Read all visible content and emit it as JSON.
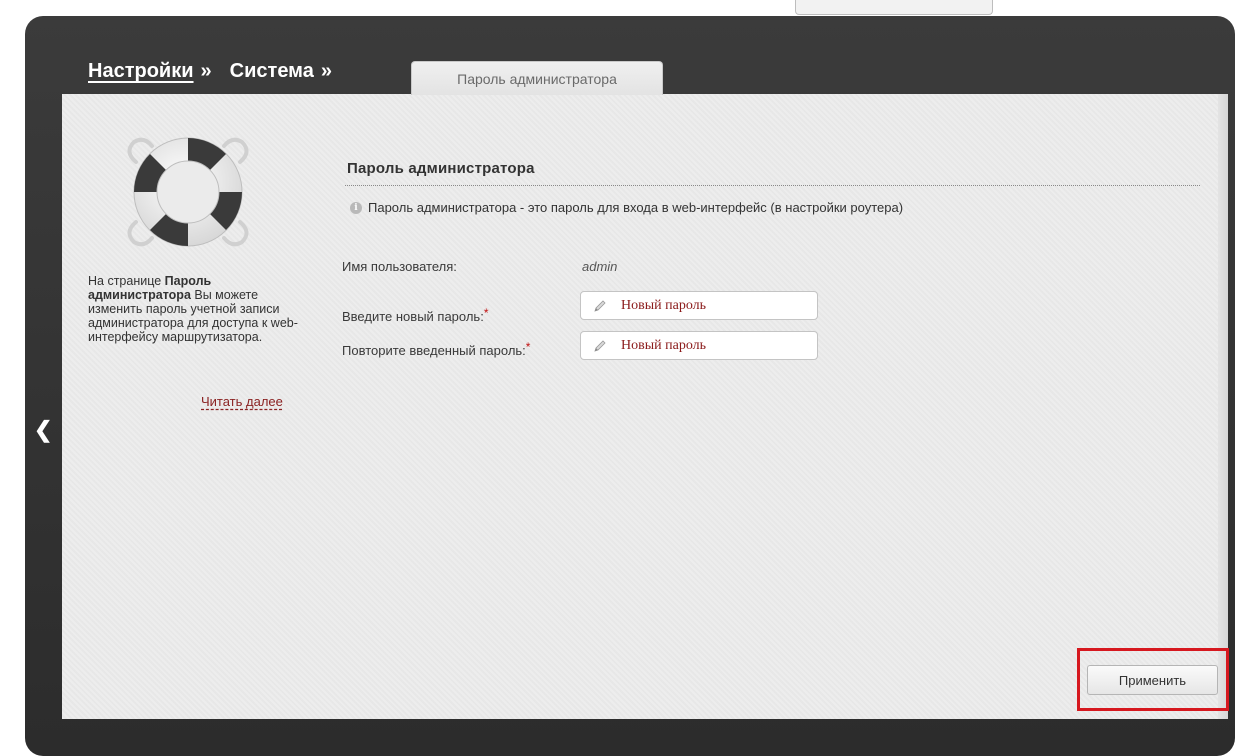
{
  "breadcrumb": {
    "settings": "Настройки",
    "system": "Система",
    "separator": "»"
  },
  "tab": {
    "label": "Пароль администратора"
  },
  "help": {
    "prefix": "На странице ",
    "page_name": "Пароль администратора",
    "suffix": " Вы можете изменить пароль учетной записи администратора для доступа к web-интерфейсу маршрутизатора.",
    "read_more": "Читать далее"
  },
  "section": {
    "title": "Пароль администратора",
    "info": "Пароль администратора - это пароль для входа в web-интерфейс (в настройки роутера)"
  },
  "form": {
    "username_label": "Имя пользователя:",
    "username_value": "admin",
    "new_password_label": "Введите новый пароль:",
    "new_password_value": "Новый пароль",
    "repeat_password_label": "Повторите введенный пароль:",
    "repeat_password_value": "Новый пароль",
    "required_mark": "*"
  },
  "actions": {
    "apply_label": "Применить"
  },
  "colors": {
    "frame": "#333333",
    "panel": "#ebebeb",
    "highlight": "#d6181f",
    "link": "#8b2222",
    "input_text": "#8b1a1a"
  },
  "icons": [
    "lifebuoy-icon",
    "info-icon",
    "pencil-icon",
    "back-arrow-icon"
  ]
}
